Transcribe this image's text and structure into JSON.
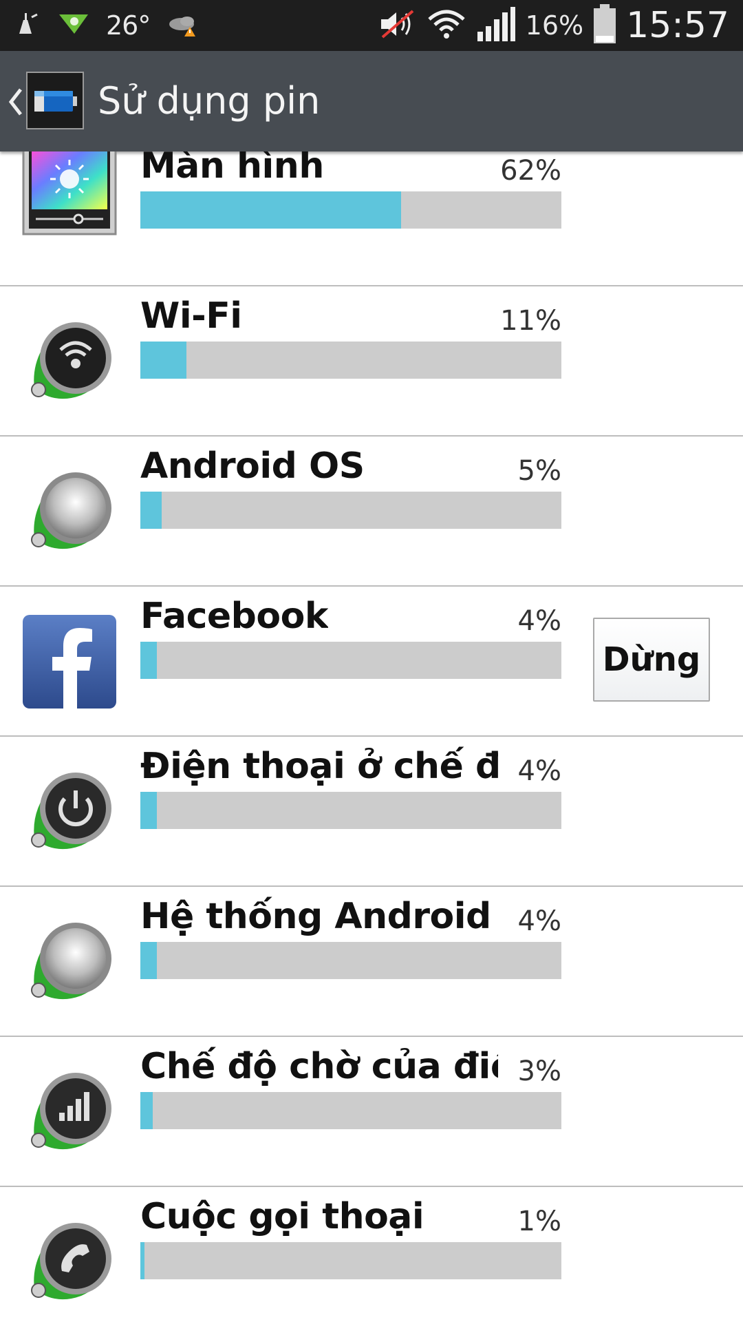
{
  "status_bar": {
    "temperature": "26°",
    "battery_percent": "16%",
    "time": "15:57",
    "icons": [
      "cleaner-icon",
      "airdroid-icon",
      "weather-icon",
      "mute-icon",
      "wifi-icon",
      "signal-icon",
      "battery-icon"
    ]
  },
  "action_bar": {
    "title": "Sử dụng pin",
    "icons": [
      "back-chevron-icon",
      "battery-app-icon"
    ]
  },
  "colors": {
    "bar_fill": "#5ec5dc",
    "bar_track": "#cccccc",
    "action_bar": "#474c52",
    "status_bar": "#1e1e1e"
  },
  "battery_usage": [
    {
      "name": "Màn hình",
      "percent_label": "62%",
      "value": 62,
      "icon": "display-brightness-icon"
    },
    {
      "name": "Wi-Fi",
      "percent_label": "11%",
      "value": 11,
      "icon": "wifi-app-icon"
    },
    {
      "name": "Android OS",
      "percent_label": "5%",
      "value": 5,
      "icon": "android-os-icon"
    },
    {
      "name": "Facebook",
      "percent_label": "4%",
      "value": 4,
      "icon": "facebook-icon",
      "action": "Dừng"
    },
    {
      "name": "Điện thoại ở chế độ...",
      "percent_label": "4%",
      "value": 4,
      "icon": "power-icon"
    },
    {
      "name": "Hệ thống Android",
      "percent_label": "4%",
      "value": 4,
      "icon": "android-system-icon"
    },
    {
      "name": "Chế độ chờ của điệ...",
      "percent_label": "3%",
      "value": 3,
      "icon": "cell-standby-icon"
    },
    {
      "name": "Cuộc gọi thoại",
      "percent_label": "1%",
      "value": 1,
      "icon": "voice-call-icon"
    }
  ]
}
